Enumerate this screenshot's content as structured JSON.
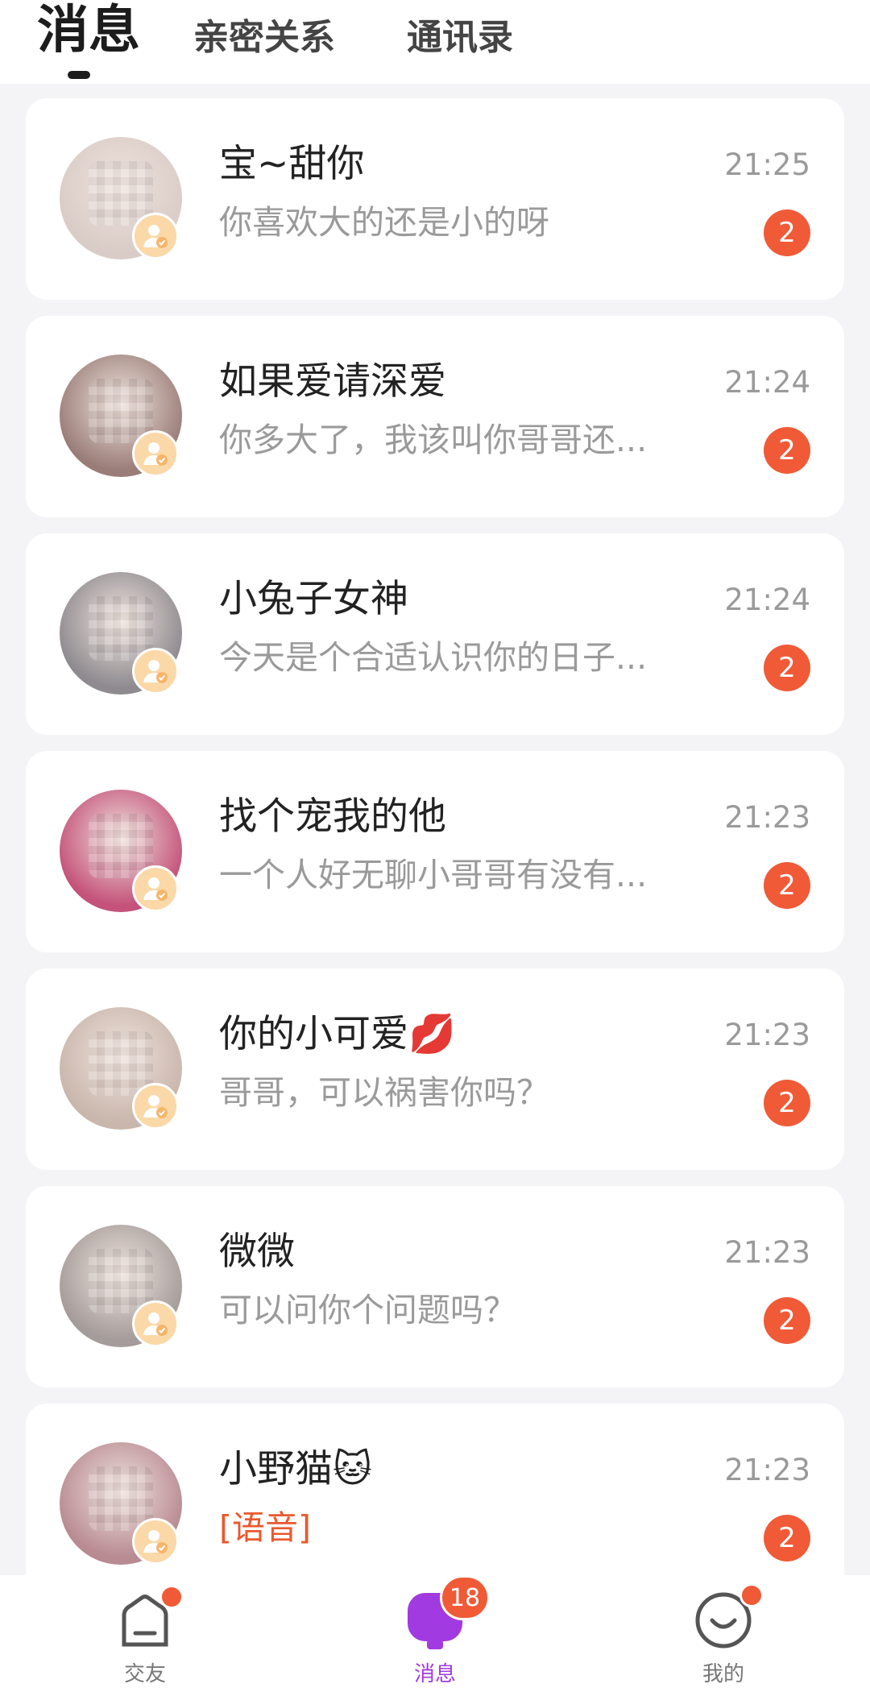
{
  "tabs": [
    {
      "label": "消息",
      "active": true
    },
    {
      "label": "亲密关系",
      "active": false
    },
    {
      "label": "通讯录",
      "active": false
    }
  ],
  "conversations": [
    {
      "name": "宝~甜你",
      "preview": "你喜欢大的还是小的呀",
      "time": "21:25",
      "unread": "2",
      "avatar_tone": "#d9ccc7"
    },
    {
      "name": "如果爱请深爱",
      "preview": "你多大了，我该叫你哥哥还...",
      "time": "21:24",
      "unread": "2",
      "avatar_tone": "#9a7d78"
    },
    {
      "name": "小兔子女神",
      "preview": "今天是个合适认识你的日子...",
      "time": "21:24",
      "unread": "2",
      "avatar_tone": "#8e8a8f"
    },
    {
      "name": "找个宠我的他",
      "preview": "一个人好无聊小哥哥有没有...",
      "time": "21:23",
      "unread": "2",
      "avatar_tone": "#c4527a"
    },
    {
      "name": "你的小可爱💋",
      "preview": "哥哥，可以祸害你吗？",
      "time": "21:23",
      "unread": "2",
      "avatar_tone": "#c9b6ac"
    },
    {
      "name": "微微",
      "preview": "可以问你个问题吗？",
      "time": "21:23",
      "unread": "2",
      "avatar_tone": "#a49c9a"
    },
    {
      "name": "小野猫🐱",
      "preview": "[语音]",
      "time": "21:23",
      "unread": "2",
      "avatar_tone": "#b88a92",
      "preview_is_voice": true
    }
  ],
  "bottom_nav": [
    {
      "label": "交友",
      "icon": "home-icon",
      "dot": true
    },
    {
      "label": "消息",
      "icon": "message-icon",
      "badge": "18",
      "active": true
    },
    {
      "label": "我的",
      "icon": "smile-icon",
      "dot": true
    }
  ],
  "colors": {
    "accent_purple": "#a13ae0",
    "badge_red": "#f05a36",
    "verify_badge": "#fbd8a8"
  }
}
